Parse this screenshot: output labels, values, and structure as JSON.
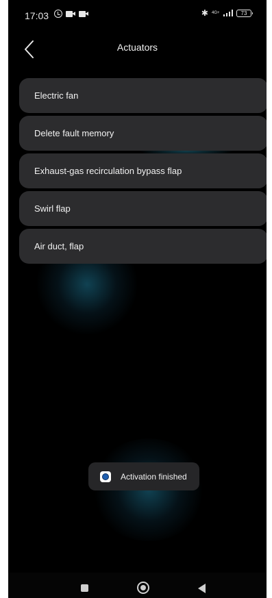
{
  "status_bar": {
    "time": "17:03",
    "icons": [
      "alarm-icon",
      "video-camera-icon",
      "video-camera-icon",
      "bluetooth-icon",
      "signal-icon"
    ],
    "network": "4G+",
    "battery": "73"
  },
  "header": {
    "back_icon": "chevron-left-icon",
    "title": "Actuators"
  },
  "actuators": {
    "items": [
      {
        "label": "Electric fan"
      },
      {
        "label": "Delete fault memory"
      },
      {
        "label": "Exhaust-gas recirculation bypass flap"
      },
      {
        "label": "Swirl flap"
      },
      {
        "label": "Air duct, flap"
      }
    ]
  },
  "toast": {
    "icon": "app-icon",
    "text": "Activation finished"
  },
  "nav_bar": {
    "icons": [
      "recents-square-icon",
      "home-circle-icon",
      "back-triangle-icon"
    ]
  },
  "colors": {
    "background": "#000000",
    "list_item": "#2c2c2e",
    "toast": "#262628",
    "glow": "#1e7896"
  }
}
